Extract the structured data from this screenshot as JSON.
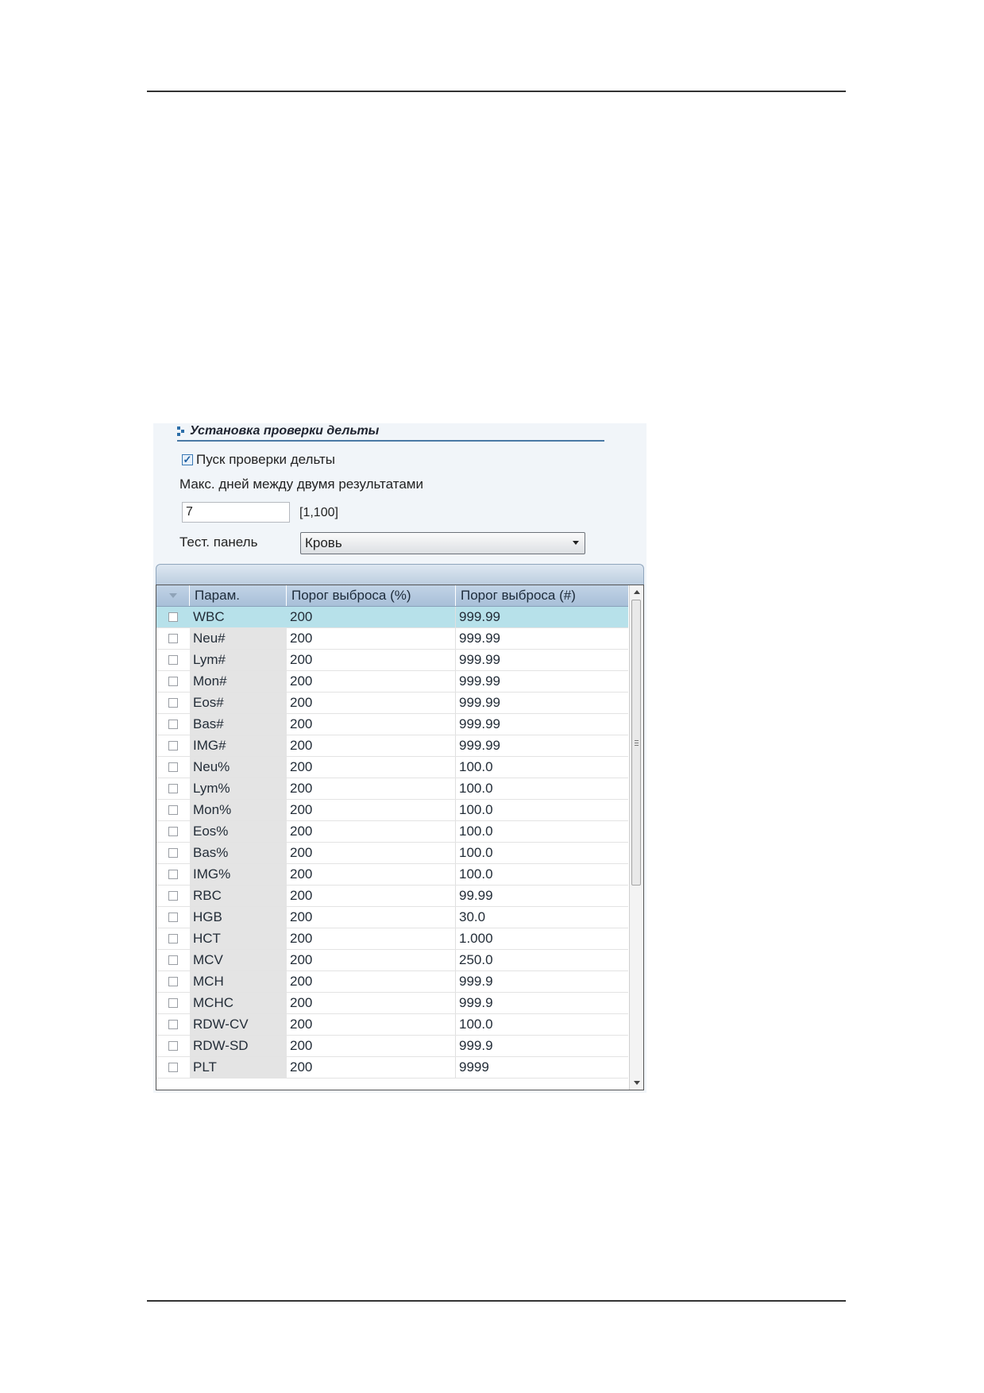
{
  "section": {
    "title": "Установка проверки дельты"
  },
  "enable": {
    "label": "Пуск проверки дельты",
    "checked": true
  },
  "max_days": {
    "label": "Макс. дней между двумя результатами",
    "value": "7",
    "range": "[1,100]"
  },
  "test_panel": {
    "label": "Тест. панель",
    "selected": "Кровь"
  },
  "table": {
    "columns": {
      "param": "Парам.",
      "pct": "Порог выброса (%)",
      "abs": "Порог выброса (#)"
    },
    "rows": [
      {
        "param": "WBC",
        "pct": "200",
        "abs": "999.99",
        "selected": true
      },
      {
        "param": "Neu#",
        "pct": "200",
        "abs": "999.99"
      },
      {
        "param": "Lym#",
        "pct": "200",
        "abs": "999.99"
      },
      {
        "param": "Mon#",
        "pct": "200",
        "abs": "999.99"
      },
      {
        "param": "Eos#",
        "pct": "200",
        "abs": "999.99"
      },
      {
        "param": "Bas#",
        "pct": "200",
        "abs": "999.99"
      },
      {
        "param": "IMG#",
        "pct": "200",
        "abs": "999.99"
      },
      {
        "param": "Neu%",
        "pct": "200",
        "abs": "100.0"
      },
      {
        "param": "Lym%",
        "pct": "200",
        "abs": "100.0"
      },
      {
        "param": "Mon%",
        "pct": "200",
        "abs": "100.0"
      },
      {
        "param": "Eos%",
        "pct": "200",
        "abs": "100.0"
      },
      {
        "param": "Bas%",
        "pct": "200",
        "abs": "100.0"
      },
      {
        "param": "IMG%",
        "pct": "200",
        "abs": "100.0"
      },
      {
        "param": "RBC",
        "pct": "200",
        "abs": "99.99"
      },
      {
        "param": "HGB",
        "pct": "200",
        "abs": "30.0"
      },
      {
        "param": "HCT",
        "pct": "200",
        "abs": "1.000"
      },
      {
        "param": "MCV",
        "pct": "200",
        "abs": "250.0"
      },
      {
        "param": "MCH",
        "pct": "200",
        "abs": "999.9"
      },
      {
        "param": "MCHC",
        "pct": "200",
        "abs": "999.9"
      },
      {
        "param": "RDW-CV",
        "pct": "200",
        "abs": "100.0"
      },
      {
        "param": "RDW-SD",
        "pct": "200",
        "abs": "999.9"
      },
      {
        "param": "PLT",
        "pct": "200",
        "abs": "9999"
      }
    ]
  },
  "icons": {
    "section": "section-bullet-icon",
    "dropdown": "chevron-down-icon",
    "sort": "sort-triangle-icon"
  },
  "colors": {
    "selected_row": "#b7e1ea",
    "header": "#b3c7dd",
    "accent": "#3a79b5"
  }
}
